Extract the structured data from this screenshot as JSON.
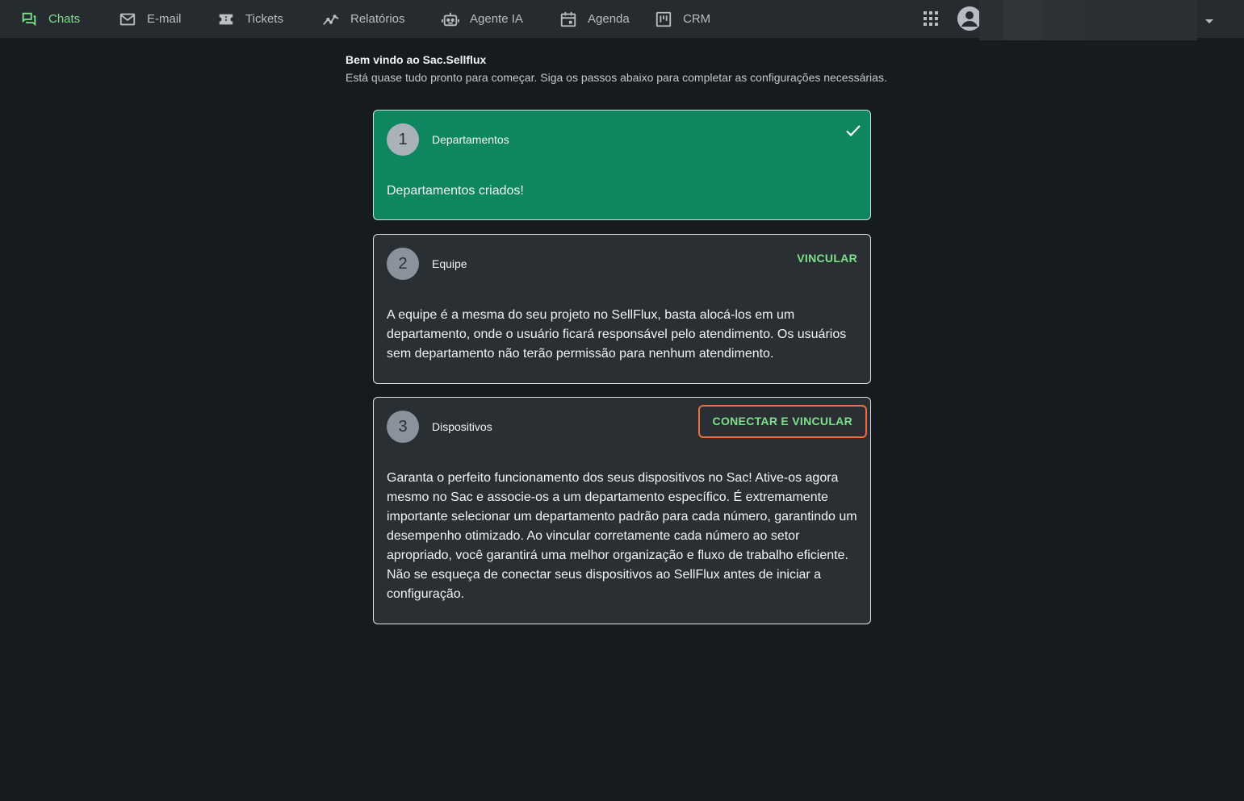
{
  "nav": {
    "items": [
      {
        "label": "Chats",
        "icon": "chats-icon",
        "active": true
      },
      {
        "label": "E-mail",
        "icon": "mail-icon"
      },
      {
        "label": "Tickets",
        "icon": "ticket-icon"
      },
      {
        "label": "Relatórios",
        "icon": "chart-line-icon"
      },
      {
        "label": "Agente IA",
        "icon": "robot-icon"
      },
      {
        "label": "Agenda",
        "icon": "calendar-icon"
      },
      {
        "label": "CRM",
        "icon": "kanban-icon"
      }
    ]
  },
  "welcome": {
    "title": "Bem vindo ao Sac.Sellflux",
    "subtitle": "Está quase tudo pronto para começar. Siga os passos abaixo para completar as configurações necessárias."
  },
  "steps": [
    {
      "number": "1",
      "title": "Departamentos",
      "status": "done",
      "body": "Departamentos criados!"
    },
    {
      "number": "2",
      "title": "Equipe",
      "action": "VINCULAR",
      "body": "A equipe é a mesma do seu projeto no SellFlux, basta alocá-los em um departamento, onde o usuário ficará responsável pelo atendimento. Os usuários sem departamento não terão permissão para nenhum atendimento."
    },
    {
      "number": "3",
      "title": "Dispositivos",
      "action": "CONECTAR E VINCULAR",
      "body": "Garanta o perfeito funcionamento dos seus dispositivos no Sac! Ative-os agora mesmo no Sac e associe-os a um departamento específico. É extremamente importante selecionar um departamento padrão para cada número, garantindo um desempenho otimizado. Ao vincular corretamente cada número ao setor apropriado, você garantirá uma melhor organização e fluxo de trabalho eficiente. Não se esqueça de conectar seus dispositivos ao SellFlux antes de iniciar a configuração."
    }
  ],
  "colors": {
    "accent": "#7ee08a",
    "done_card": "#0e8660",
    "highlight_border": "#f26d3d",
    "background": "#161b1f",
    "topbar": "#262b2f"
  }
}
